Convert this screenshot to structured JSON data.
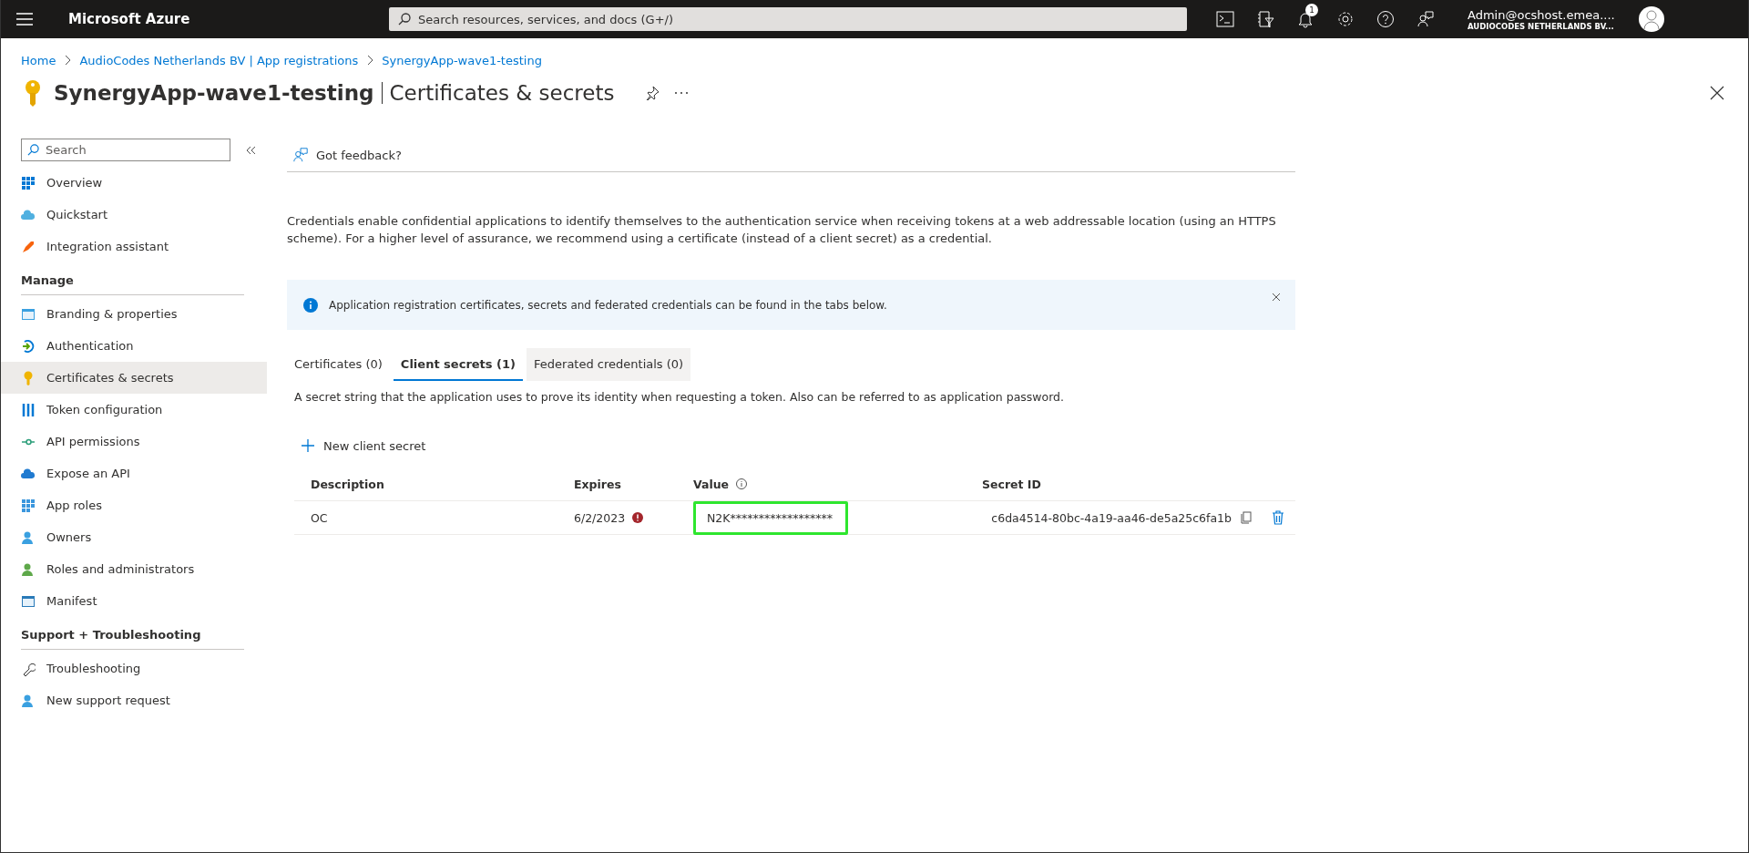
{
  "topbar": {
    "brand": "Microsoft Azure",
    "search": {
      "placeholder": "Search resources, services, and docs (G+/)"
    },
    "notification_count": "1",
    "account": {
      "name": "Admin@ocshost.emea....",
      "tenant": "AUDIOCODES NETHERLANDS BV..."
    }
  },
  "breadcrumb": [
    "Home",
    "AudioCodes Netherlands BV | App registrations",
    "SynergyApp-wave1-testing"
  ],
  "page": {
    "title": "SynergyApp-wave1-testing",
    "subtitle": "Certificates & secrets"
  },
  "sidebar": {
    "search": {
      "placeholder": "Search"
    },
    "sections": [
      {
        "items": [
          {
            "label": "Overview",
            "selected": false
          },
          {
            "label": "Quickstart",
            "selected": false
          },
          {
            "label": "Integration assistant",
            "selected": false
          }
        ]
      },
      {
        "heading": "Manage",
        "items": [
          {
            "label": "Branding & properties",
            "selected": false
          },
          {
            "label": "Authentication",
            "selected": false
          },
          {
            "label": "Certificates & secrets",
            "selected": true
          },
          {
            "label": "Token configuration",
            "selected": false
          },
          {
            "label": "API permissions",
            "selected": false
          },
          {
            "label": "Expose an API",
            "selected": false
          },
          {
            "label": "App roles",
            "selected": false
          },
          {
            "label": "Owners",
            "selected": false
          },
          {
            "label": "Roles and administrators",
            "selected": false
          },
          {
            "label": "Manifest",
            "selected": false
          }
        ]
      },
      {
        "heading": "Support + Troubleshooting",
        "items": [
          {
            "label": "Troubleshooting",
            "selected": false
          },
          {
            "label": "New support request",
            "selected": false
          }
        ]
      }
    ]
  },
  "toolbar": {
    "feedback": "Got feedback?"
  },
  "intro": "Credentials enable confidential applications to identify themselves to the authentication service when receiving tokens at a web addressable location (using an HTTPS scheme). For a higher level of assurance, we recommend using a certificate (instead of a client secret) as a credential.",
  "info_banner": "Application registration certificates, secrets and federated credentials can be found in the tabs below.",
  "tabs": [
    {
      "label": "Certificates (0)",
      "selected": false,
      "hovered": false
    },
    {
      "label": "Client secrets (1)",
      "selected": true,
      "hovered": false
    },
    {
      "label": "Federated credentials (0)",
      "selected": false,
      "hovered": true
    }
  ],
  "tab_description": "A secret string that the application uses to prove its identity when requesting a token. Also can be referred to as application password.",
  "new_button": "New client secret",
  "table": {
    "columns": [
      "Description",
      "Expires",
      "Value",
      "Secret ID"
    ],
    "rows": [
      {
        "description": "OC",
        "expires": "6/2/2023",
        "expired": true,
        "value": "N2K******************",
        "value_highlighted": true,
        "secret_id": "c6da4514-80bc-4a19-aa46-de5a25c6fa1b"
      }
    ]
  }
}
